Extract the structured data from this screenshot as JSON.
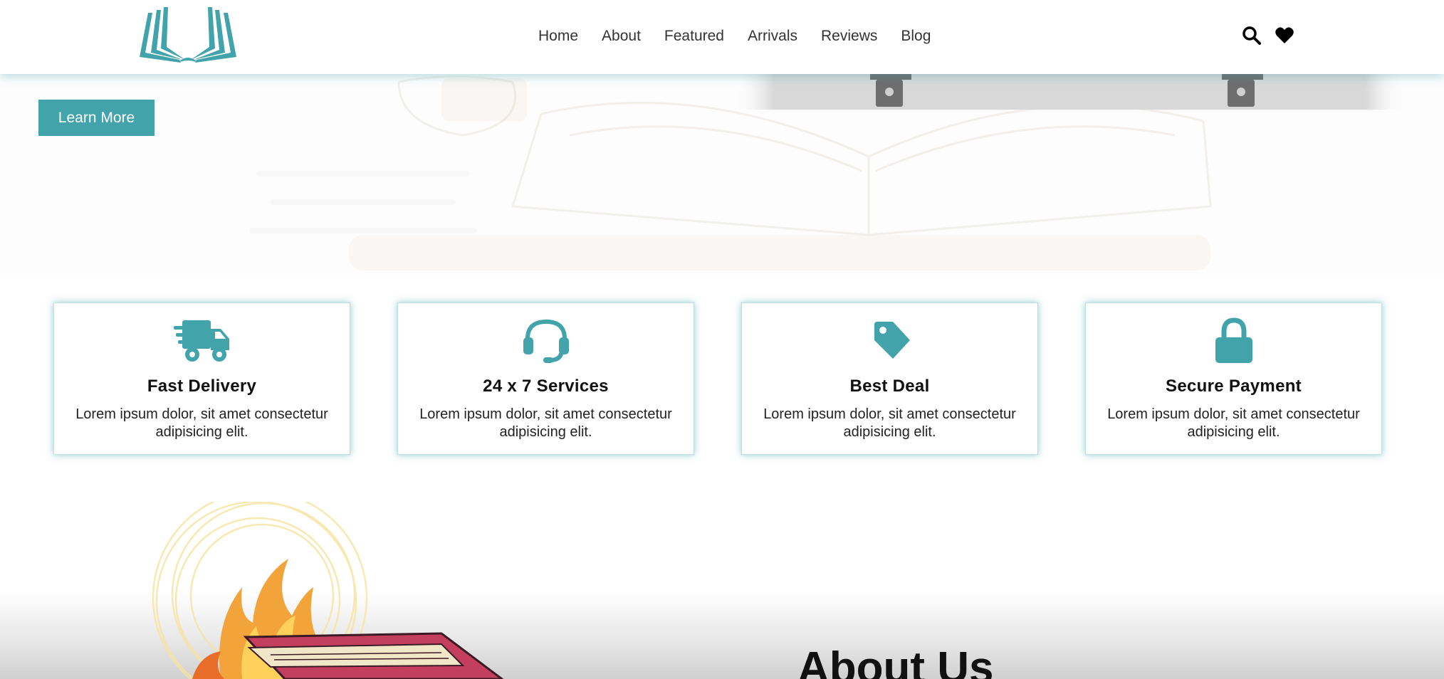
{
  "header": {
    "logo": "open-book-logo",
    "nav": [
      "Home",
      "About",
      "Featured",
      "Arrivals",
      "Reviews",
      "Blog"
    ],
    "icons": [
      "search-icon",
      "heart-icon"
    ]
  },
  "hero": {
    "button_label": "Learn More"
  },
  "features": [
    {
      "icon": "truck-icon",
      "title": "Fast Delivery",
      "text": "Lorem ipsum dolor, sit amet consectetur adipisicing elit."
    },
    {
      "icon": "headset-icon",
      "title": "24 x 7 Services",
      "text": "Lorem ipsum dolor, sit amet consectetur adipisicing elit."
    },
    {
      "icon": "tag-icon",
      "title": "Best Deal",
      "text": "Lorem ipsum dolor, sit amet consectetur adipisicing elit."
    },
    {
      "icon": "lock-icon",
      "title": "Secure Payment",
      "text": "Lorem ipsum dolor, sit amet consectetur adipisicing elit."
    }
  ],
  "about": {
    "title": "About Us",
    "image": "burning-book-illustration"
  },
  "colors": {
    "accent": "#42a3aa",
    "text": "#111111"
  }
}
